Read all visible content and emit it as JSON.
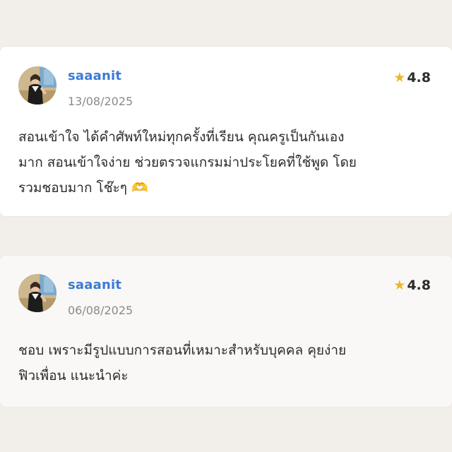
{
  "reviews": [
    {
      "reviewer_name": "saaanit",
      "date": "13/08/2025",
      "rating": "4.8",
      "rating_icon": "star-icon",
      "text": "สอนเข้าใจ ได้คำศัพท์ใหม่ทุกครั้งที่เรียน คุณครูเป็นกันเอง\nมาก สอนเข้าใจง่าย ช่วยตรวจแกรมม่าประโยคที่ใช้พูด โดย\nรวมชอบมาก โช๊ะๆ 🫶"
    },
    {
      "reviewer_name": "saaanit",
      "date": "06/08/2025",
      "rating": "4.8",
      "rating_icon": "star-icon",
      "text": "ชอบ เพราะมีรูปแบบการสอนที่เหมาะสำหรับบุคคล คุยง่าย\nฟิวเพื่อน แนะนำค่ะ"
    }
  ],
  "colors": {
    "background": "#f2efea",
    "card": "#ffffff",
    "name": "#3b7bd4",
    "star": "#f0b429",
    "date": "#8a8a8a",
    "text": "#2b2b2b"
  }
}
